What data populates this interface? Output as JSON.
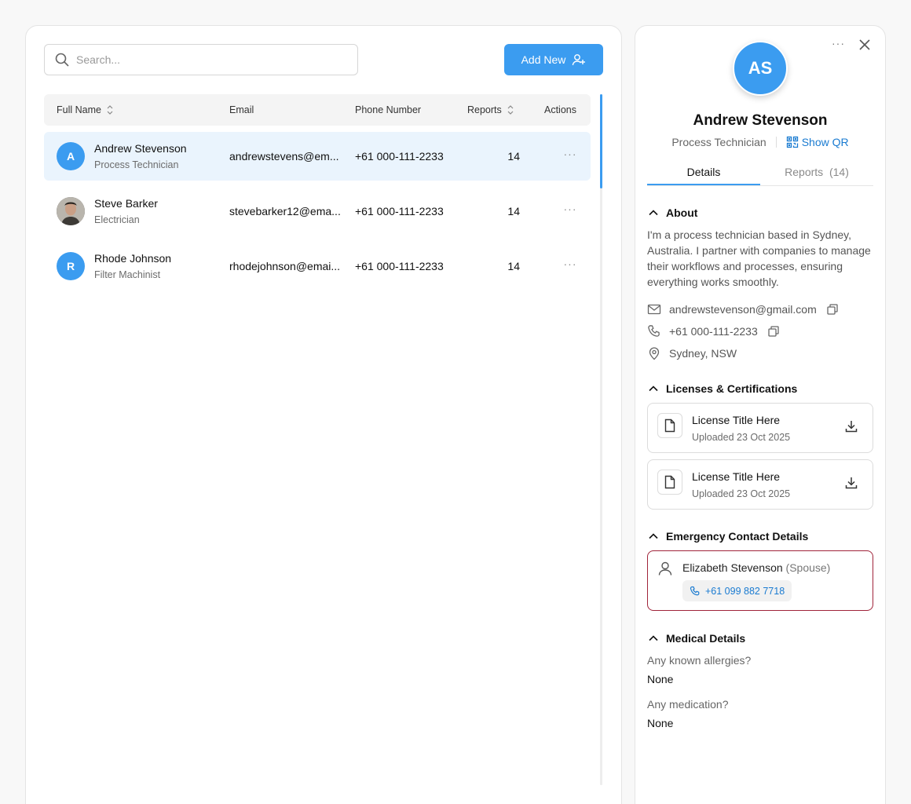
{
  "colors": {
    "accent": "#3b9cf0",
    "link": "#1a7bd1",
    "emergency_border": "#a0243a",
    "selected_row": "#eaf4fd"
  },
  "search": {
    "placeholder": "Search...",
    "value": ""
  },
  "toolbar": {
    "add_label": "Add New",
    "add_icon": "user-plus-icon"
  },
  "table": {
    "headers": {
      "full_name": "Full Name",
      "email": "Email",
      "phone": "Phone Number",
      "reports": "Reports",
      "actions": "Actions"
    },
    "rows": [
      {
        "initial": "A",
        "name": "Andrew Stevenson",
        "role": "Process Technician",
        "email": "andrewstevens@em...",
        "phone": "+61 000-111-2233",
        "reports": "14",
        "actions": "···",
        "selected": true
      },
      {
        "initial": "",
        "name": "Steve Barker",
        "role": "Electrician",
        "email": "stevebarker12@ema...",
        "phone": "+61 000-111-2233",
        "reports": "14",
        "actions": "···",
        "selected": false
      },
      {
        "initial": "R",
        "name": "Rhode Johnson",
        "role": "Filter Machinist",
        "email": "rhodejohnson@emai...",
        "phone": "+61 000-111-2233",
        "reports": "14",
        "actions": "···",
        "selected": false
      }
    ]
  },
  "detail": {
    "initials": "AS",
    "menu": "···",
    "name": "Andrew Stevenson",
    "role": "Process Technician",
    "show_qr": "Show QR",
    "tabs": {
      "details": "Details",
      "reports": "Reports",
      "reports_count": "(14)"
    },
    "about": {
      "title": "About",
      "text": "I'm a process technician based in Sydney, Australia. I partner with companies to manage their workflows and processes, ensuring everything works smoothly.",
      "email": "andrewstevenson@gmail.com",
      "phone": "+61 000-111-2233",
      "location": "Sydney, NSW"
    },
    "licenses": {
      "title": "Licenses & Certifications",
      "items": [
        {
          "title": "License Title Here",
          "date": "Uploaded 23 Oct 2025"
        },
        {
          "title": "License Title Here",
          "date": "Uploaded 23 Oct 2025"
        }
      ]
    },
    "emergency": {
      "title": "Emergency Contact Details",
      "name": "Elizabeth Stevenson",
      "relation": "(Spouse)",
      "phone": "+61 099 882 7718"
    },
    "medical": {
      "title": "Medical Details",
      "q1": "Any known allergies?",
      "a1": "None",
      "q2": "Any medication?",
      "a2": "None"
    }
  }
}
